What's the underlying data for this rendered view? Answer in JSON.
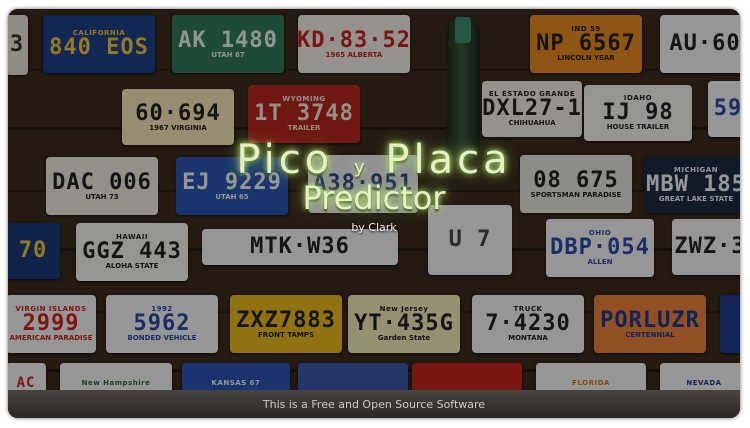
{
  "window": {
    "title_line1": "Pico",
    "title_connector": "y",
    "title_line1b": "Placa",
    "title_line2": "Predictor",
    "author": "by Clark",
    "footer_text": "This is a Free and Open Source Software"
  },
  "plates": [
    {
      "top": "CALIFORNIA",
      "num": "840 EOS",
      "bot": ""
    },
    {
      "top": "",
      "num": "AK 1480",
      "bot": "UTAH 67"
    },
    {
      "top": "",
      "num": "KD·83·52",
      "bot": "1965 ALBERTA"
    },
    {
      "top": "IND 59",
      "num": "NP 6567",
      "bot": "LINCOLN YEAR"
    },
    {
      "top": "",
      "num": "AU·60",
      "bot": ""
    },
    {
      "top": "",
      "num": "60·694",
      "bot": "1967 VIRGINIA"
    },
    {
      "top": "WYOMING",
      "num": "1T 3748",
      "bot": "TRAILER"
    },
    {
      "top": "EL ESTADO GRANDE",
      "num": "DXL27-1",
      "bot": "CHIHUAHUA"
    },
    {
      "top": "IDAHO",
      "num": "IJ 98",
      "bot": "HOUSE TRAILER"
    },
    {
      "top": "",
      "num": "DAC 006",
      "bot": "UTAH 73"
    },
    {
      "top": "",
      "num": "EJ 9229",
      "bot": "UTAH 65"
    },
    {
      "top": "",
      "num": "A38·951",
      "bot": ""
    },
    {
      "top": "",
      "num": "08 675",
      "bot": "SPORTSMAN PARADISE"
    },
    {
      "top": "MICHIGAN",
      "num": "MBW 185",
      "bot": "GREAT LAKE STATE"
    },
    {
      "top": "HAWAII",
      "num": "GGZ 443",
      "bot": "ALOHA STATE"
    },
    {
      "top": "",
      "num": "MTK·W36",
      "bot": ""
    },
    {
      "top": "OHIO",
      "num": "DBP·054",
      "bot": "ALLEN"
    },
    {
      "top": "",
      "num": "ZWZ·3",
      "bot": ""
    },
    {
      "top": "VIRGIN ISLANDS",
      "num": "2999",
      "bot": "AMERICAN PARADISE"
    },
    {
      "top": "1992",
      "num": "5962",
      "bot": "BONDED VEHICLE"
    },
    {
      "top": "",
      "num": "ZXZ7883",
      "bot": "FRONT TAMPS"
    },
    {
      "top": "New Jersey",
      "num": "YT·435G",
      "bot": "Garden State"
    },
    {
      "top": "TRUCK",
      "num": "7·4230",
      "bot": "MONTANA"
    },
    {
      "top": "",
      "num": "PORLUZR",
      "bot": "CENTENNIAL"
    },
    {
      "top": "New Hampshire",
      "num": "",
      "bot": ""
    },
    {
      "top": "KANSAS 67",
      "num": "",
      "bot": ""
    },
    {
      "top": "FLORIDA",
      "num": "",
      "bot": ""
    },
    {
      "top": "NEVADA",
      "num": "",
      "bot": ""
    }
  ]
}
